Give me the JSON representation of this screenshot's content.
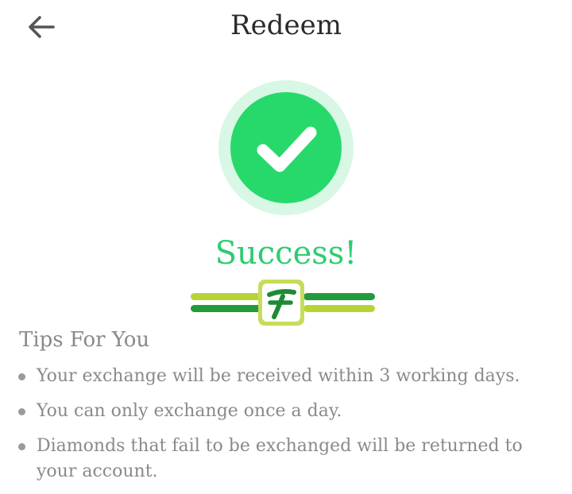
{
  "header": {
    "title": "Redeem",
    "back_icon": "arrow-left-icon"
  },
  "status": {
    "icon": "check-circle-icon",
    "text": "Success!",
    "colors": {
      "primary": "#27d96b",
      "ring": "#d8f7e4",
      "text": "#2ecc71"
    }
  },
  "logo": {
    "icon": "brand-logo-icon"
  },
  "tips": {
    "title": "Tips For You",
    "items": [
      "Your exchange will be received within 3 working days.",
      "You can only exchange once a day.",
      "Diamonds that fail to be exchanged will be returned to your account."
    ]
  }
}
